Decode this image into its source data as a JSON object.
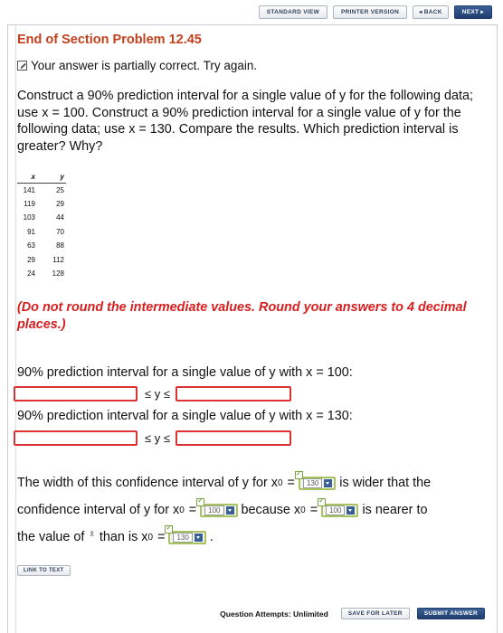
{
  "nav": {
    "standard_view": "STANDARD VIEW",
    "printer_version": "PRINTER VERSION",
    "back": "◂ BACK",
    "next": "NEXT ▸"
  },
  "title": "End of Section Problem 12.45",
  "status": "Your answer is partially correct.  Try again.",
  "question": "Construct a 90% prediction interval for a single value of y for the following data; use x = 100. Construct a 90% prediction interval for a single value of y for the following data; use x = 130. Compare the results. Which prediction interval is greater? Why?",
  "table": {
    "headers": [
      "x",
      "y"
    ],
    "rows": [
      [
        "141",
        "25"
      ],
      [
        "119",
        "29"
      ],
      [
        "103",
        "44"
      ],
      [
        "91",
        "70"
      ],
      [
        "63",
        "88"
      ],
      [
        "29",
        "112"
      ],
      [
        "24",
        "128"
      ]
    ]
  },
  "rounding_note": "(Do not round the intermediate values. Round your answers to 4 decimal places.)",
  "pi1": {
    "label": "90% prediction interval for a single value of y with x = 100:",
    "lower_value": "",
    "upper_value": "",
    "middle": "≤ y ≤"
  },
  "pi2": {
    "label": "90% prediction interval for a single value of y with x = 130:",
    "lower_value": "",
    "upper_value": "",
    "middle": "≤ y ≤"
  },
  "compare": {
    "line1_pre": "The width of this confidence interval of y for x",
    "line1_post": "is wider that the",
    "line2_pre": "confidence interval of y for x",
    "line2_mid": "because x",
    "line2_post": "is nearer to",
    "line3_pre": "the value of",
    "line3_mid": "than is x",
    "subscript": "0",
    "equals": "=",
    "xbar": "x̄",
    "period": ".",
    "select1": "130",
    "select2": "100",
    "select3": "100",
    "select4": "130"
  },
  "link_to_text": "LINK TO TEXT",
  "footer": {
    "attempts": "Question Attempts: Unlimited",
    "save": "SAVE FOR LATER",
    "submit": "SUBMIT ANSWER"
  },
  "colors": {
    "title": "#c4401d",
    "warning": "#d81f1f",
    "error_border": "#dd3333",
    "correct_border": "#a7c35e",
    "button_blue": "#1f3d6d"
  }
}
